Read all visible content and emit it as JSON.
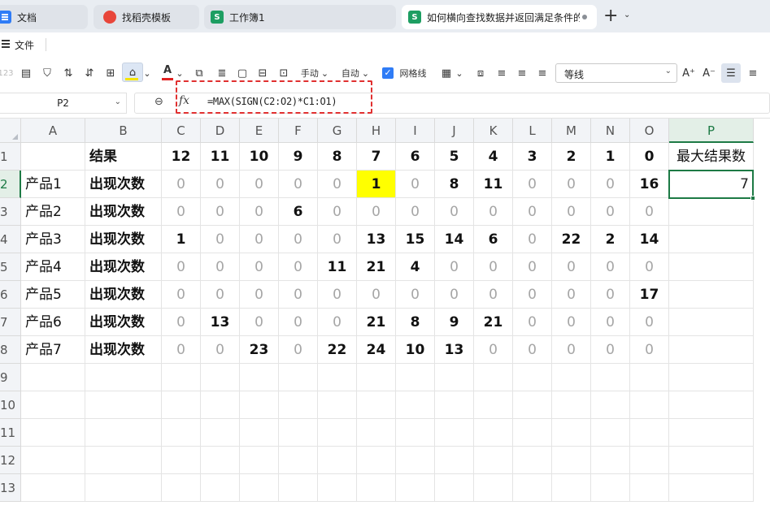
{
  "tabs": [
    {
      "label": "文档",
      "icon": "doc-icon",
      "active": false
    },
    {
      "label": "找稻壳模板",
      "icon": "template-icon",
      "active": false
    },
    {
      "label": "工作簿1",
      "icon": "sheet-icon",
      "active": false
    },
    {
      "label": "如何横向查找数据并返回满足条件的",
      "icon": "sheet-icon",
      "active": true
    }
  ],
  "new_tab": "+",
  "menu": {
    "file_label": "文件"
  },
  "toolbar": {
    "manual_label": "手动",
    "auto_label": "自动",
    "gridlines_label": "网格线",
    "gridlines_checked": true,
    "font_name": "等线",
    "fill_color": "#f5e400",
    "font_color": "#e02020"
  },
  "formula_bar": {
    "cell_ref": "P2",
    "fx": "fx",
    "formula": "=MAX(SIGN(C2:O2)*C1:O1)"
  },
  "sheet": {
    "columns": [
      "A",
      "B",
      "C",
      "D",
      "E",
      "F",
      "G",
      "H",
      "I",
      "J",
      "K",
      "L",
      "M",
      "N",
      "O",
      "P"
    ],
    "row_numbers": [
      "1",
      "2",
      "3",
      "4",
      "5",
      "6",
      "7",
      "8",
      "9",
      "10",
      "11",
      "12",
      "13"
    ],
    "header_row": {
      "a": "",
      "b": "结果",
      "values": [
        "12",
        "11",
        "10",
        "9",
        "8",
        "7",
        "6",
        "5",
        "4",
        "3",
        "2",
        "1",
        "0"
      ],
      "p": "最大结果数"
    },
    "data_rows": [
      {
        "product": "产品1",
        "label": "出现次数",
        "values": [
          "0",
          "0",
          "0",
          "0",
          "0",
          "1",
          "0",
          "8",
          "11",
          "0",
          "0",
          "0",
          "16"
        ],
        "p": "7"
      },
      {
        "product": "产品2",
        "label": "出现次数",
        "values": [
          "0",
          "0",
          "0",
          "6",
          "0",
          "0",
          "0",
          "0",
          "0",
          "0",
          "0",
          "0",
          "0"
        ],
        "p": ""
      },
      {
        "product": "产品3",
        "label": "出现次数",
        "values": [
          "1",
          "0",
          "0",
          "0",
          "0",
          "13",
          "15",
          "14",
          "6",
          "0",
          "22",
          "2",
          "14"
        ],
        "p": ""
      },
      {
        "product": "产品4",
        "label": "出现次数",
        "values": [
          "0",
          "0",
          "0",
          "0",
          "11",
          "21",
          "4",
          "0",
          "0",
          "0",
          "0",
          "0",
          "0"
        ],
        "p": ""
      },
      {
        "product": "产品5",
        "label": "出现次数",
        "values": [
          "0",
          "0",
          "0",
          "0",
          "0",
          "0",
          "0",
          "0",
          "0",
          "0",
          "0",
          "0",
          "17"
        ],
        "p": ""
      },
      {
        "product": "产品6",
        "label": "出现次数",
        "values": [
          "0",
          "13",
          "0",
          "0",
          "0",
          "21",
          "8",
          "9",
          "21",
          "0",
          "0",
          "0",
          "0"
        ],
        "p": ""
      },
      {
        "product": "产品7",
        "label": "出现次数",
        "values": [
          "0",
          "0",
          "23",
          "0",
          "22",
          "24",
          "10",
          "13",
          "0",
          "0",
          "0",
          "0",
          "0"
        ],
        "p": ""
      }
    ],
    "selected_cell": "P2",
    "highlight_cell": "H2",
    "highlight_color": "#ffff00",
    "selection_color": "#1d7a45"
  }
}
